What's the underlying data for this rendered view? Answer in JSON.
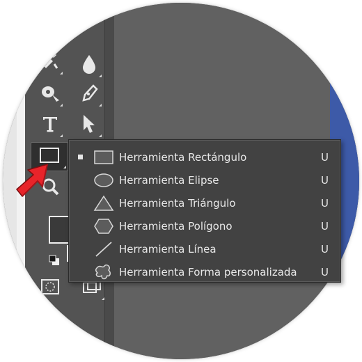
{
  "toolbar": {
    "tools": [
      {
        "name": "brush-tool",
        "icon": "brush-icon"
      },
      {
        "name": "blur-tool",
        "icon": "water-drop-icon"
      },
      {
        "name": "dodge-tool",
        "icon": "dodge-icon"
      },
      {
        "name": "pen-tool",
        "icon": "pen-nib-icon"
      },
      {
        "name": "type-tool",
        "icon": "type-t-icon"
      },
      {
        "name": "path-selection-tool",
        "icon": "arrow-pointer-icon"
      },
      {
        "name": "rectangle-tool",
        "icon": "rectangle-icon",
        "active": true
      },
      {
        "name": "zoom-tool",
        "icon": "magnifier-icon"
      }
    ]
  },
  "shape_menu": {
    "items": [
      {
        "label": "Herramienta Rectángulo",
        "shortcut": "U",
        "icon": "rectangle-icon",
        "selected": true
      },
      {
        "label": "Herramienta Elipse",
        "shortcut": "U",
        "icon": "ellipse-icon",
        "selected": false
      },
      {
        "label": "Herramienta Triángulo",
        "shortcut": "U",
        "icon": "triangle-icon",
        "selected": false
      },
      {
        "label": "Herramienta Polígono",
        "shortcut": "U",
        "icon": "hexagon-icon",
        "selected": false
      },
      {
        "label": "Herramienta Línea",
        "shortcut": "U",
        "icon": "line-icon",
        "selected": false
      },
      {
        "label": "Herramienta Forma personalizada",
        "shortcut": "U",
        "icon": "custom-shape-icon",
        "selected": false
      }
    ]
  },
  "colors": {
    "toolbar_bg": "#535353",
    "menu_bg": "#424242",
    "canvas_bg": "#616161",
    "accent_arrow": "#e8242a",
    "blue_strip": "#3d5aa8"
  }
}
